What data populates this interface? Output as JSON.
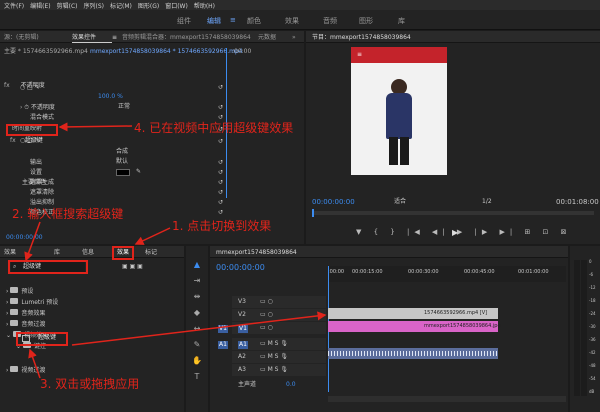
{
  "menu": [
    "文件(F)",
    "编辑(E)",
    "剪辑(C)",
    "序列(S)",
    "标记(M)",
    "图形(G)",
    "窗口(W)",
    "帮助(H)"
  ],
  "workspaces": [
    "组件",
    "编辑",
    "颜色",
    "效果",
    "音频",
    "图形",
    "库"
  ],
  "ws_menu": "≡",
  "effect_controls": {
    "tabs": [
      "源：(无剪辑)",
      "效果控件",
      "音频剪辑混合器：mmexport1574858039864",
      "元数据"
    ],
    "tab_menu": "≡",
    "expand_arrow": "»",
    "clip_label": "主要 * 1574663592966.mp4",
    "seq_label": "mmexport1574858039864 * 1574663592966.mp4",
    "timecode_ruler": ":00:00",
    "opacity": "不透明度",
    "opacity_label": "不透明度",
    "opacity_value": "100.0 %",
    "blend_mode": "混合模式",
    "blend_value": "正常",
    "time_remap": "时间重映射",
    "keyer": "超级键",
    "output": "输出",
    "output_value": "合成",
    "setting": "设置",
    "setting_value": "默认",
    "key_color": "主要颜色",
    "matte_gen": "遮罩生成",
    "matte_clean": "遮罩清除",
    "spill": "溢出抑制",
    "color_correct": "颜色校正",
    "timecode": "00:00:00:00"
  },
  "program": {
    "title": "节目：mmexport1574858039864",
    "timecode": "00:00:00:00",
    "fit": "适合",
    "ratio": "1/2",
    "duration": "00:01:08:00"
  },
  "effects_panel": {
    "tabs": [
      "效果",
      "库",
      "信息",
      "效果",
      "标记"
    ],
    "search_value": "超级键",
    "tree": [
      "预设",
      "Lumetri 预设",
      "音频效果",
      "音频过渡",
      "视频效果",
      "键控",
      "超级键",
      "视频过渡"
    ]
  },
  "timeline": {
    "title": "mmexport1574858039864",
    "timecode": "00:00:00:00",
    "ruler": [
      ":00:00",
      "00:00:15:00",
      "00:00:30:00",
      "00:00:45:00",
      "00:01:00:00"
    ],
    "tracks_v": [
      "V3",
      "V2",
      "V1"
    ],
    "tracks_a": [
      "A1",
      "A2",
      "A3"
    ],
    "src_v": "V1",
    "src_a": "A1",
    "master": "主声道",
    "master_value": "0.0",
    "clip1": "1574663592966.mp4 [V]",
    "clip2": "mmexport1574858039864.jpg",
    "meter_labels": [
      "0",
      "-6",
      "-12",
      "-18",
      "-24",
      "-30",
      "-36",
      "-42",
      "-48",
      "-54",
      "dB"
    ]
  },
  "annotations": {
    "a1": "1. 点击切换到效果",
    "a2": "2. 输入框搜索超级键",
    "a3": "3. 双击或拖拽应用",
    "a4": "4. 已在视频中应用超级键效果"
  },
  "program_preview": {
    "banner": "≡"
  },
  "icons": [
    "reset-icon",
    "eyedropper-icon",
    "search-icon",
    "play-icon",
    "folder-icon"
  ]
}
